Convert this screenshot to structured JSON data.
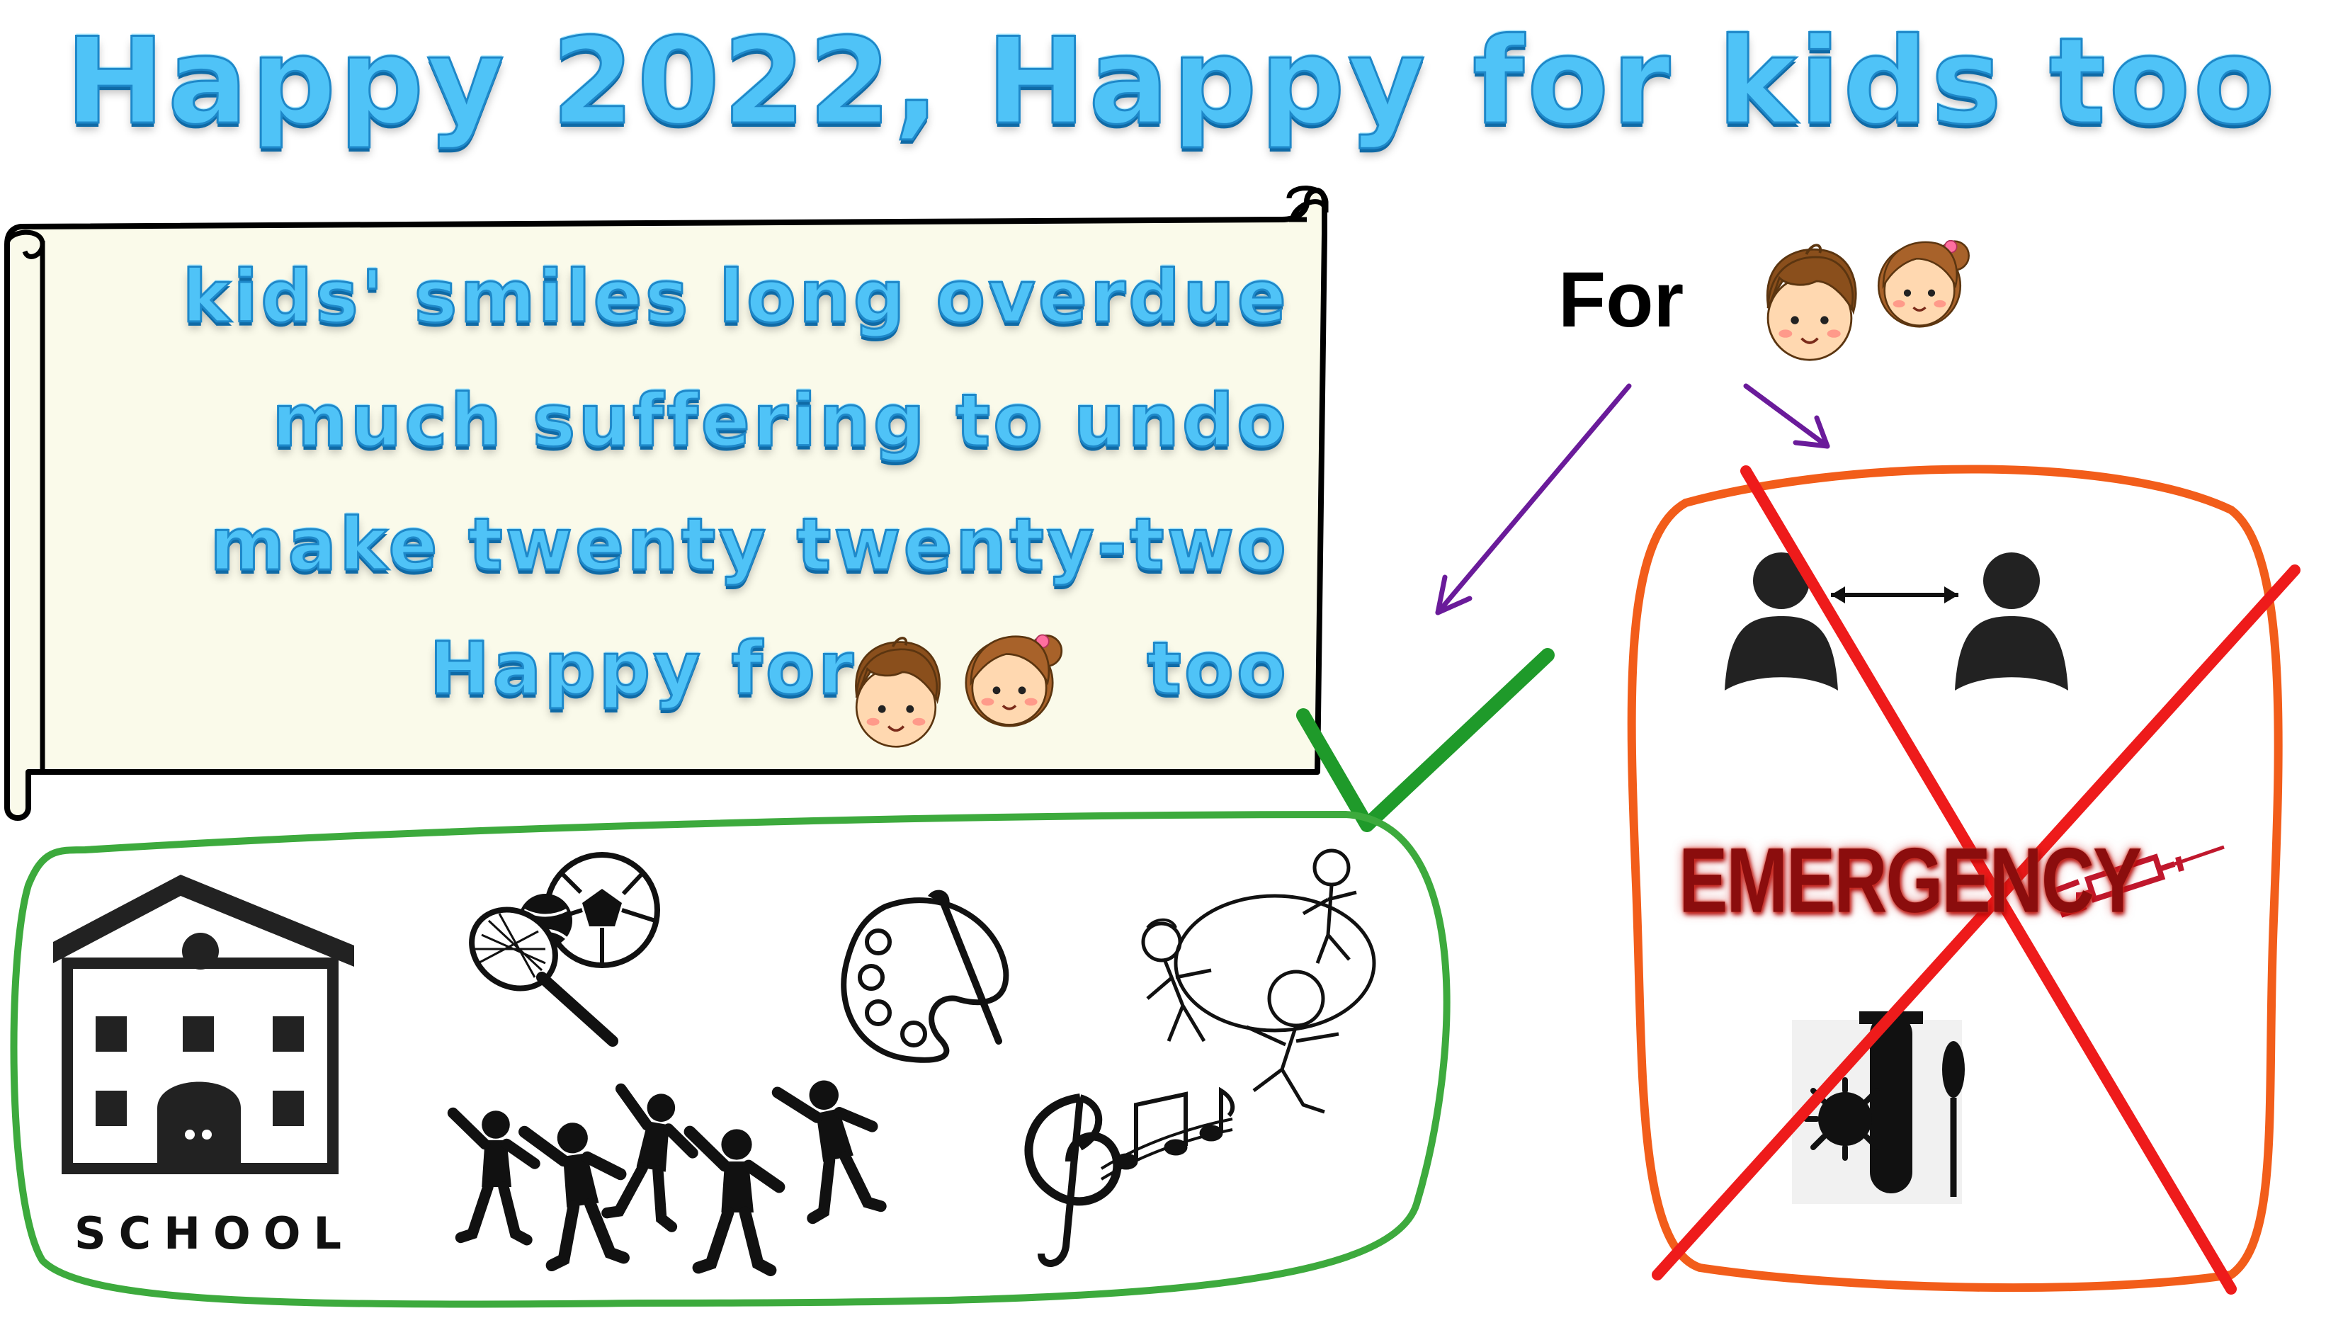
{
  "title": "Happy 2022, Happy for kids too",
  "scroll": {
    "line1": "kids' smiles long overdue",
    "line2": "much suffering to undo",
    "line3": "make twenty twenty-two",
    "line4_start": "Happy for",
    "line4_end": "too"
  },
  "for_label": "For",
  "school_label": "SCHOOL",
  "emergency_label": "EMERGENCY",
  "colors": {
    "title_blue": "#4fc3f7",
    "scroll_fill": "#fafaea",
    "good_green": "#3daa3d",
    "check_green": "#1f9a2a",
    "bad_orange": "#f25d1a",
    "cross_red": "#ee1b1b",
    "arrow_purple": "#6a1b9a"
  },
  "icons": {
    "kids": "boy-and-girl-face-icon",
    "good": [
      "school-building-icon",
      "sports-ball-racket-icon",
      "paint-palette-icon",
      "kids-playing-circle-icon",
      "dancing-kids-silhouette-icon",
      "music-notes-icon"
    ],
    "bad": [
      "social-distance-people-icon",
      "emergency-text-icon",
      "syringe-icon",
      "virus-test-tube-icon"
    ]
  }
}
